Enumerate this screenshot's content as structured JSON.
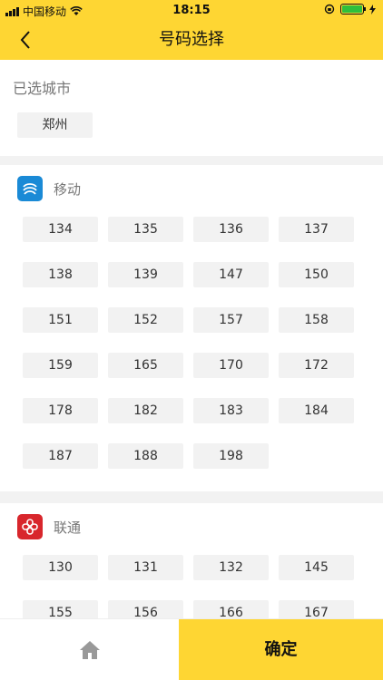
{
  "status_bar": {
    "carrier": "中国移动",
    "time": "18:15",
    "battery_color": "#2fbf3c"
  },
  "nav": {
    "title": "号码选择"
  },
  "selected": {
    "title": "已选城市",
    "city": "郑州"
  },
  "mobile": {
    "name": "移动",
    "prefixes": [
      "134",
      "135",
      "136",
      "137",
      "138",
      "139",
      "147",
      "150",
      "151",
      "152",
      "157",
      "158",
      "159",
      "165",
      "170",
      "172",
      "178",
      "182",
      "183",
      "184",
      "187",
      "188",
      "198"
    ]
  },
  "unicom": {
    "name": "联通",
    "prefixes": [
      "130",
      "131",
      "132",
      "145",
      "155",
      "156",
      "166",
      "167"
    ]
  },
  "bottom": {
    "confirm_label": "确定"
  },
  "colors": {
    "brand_yellow": "#fed633",
    "mobile_blue": "#1a8ad6",
    "unicom_red": "#d8262c"
  }
}
